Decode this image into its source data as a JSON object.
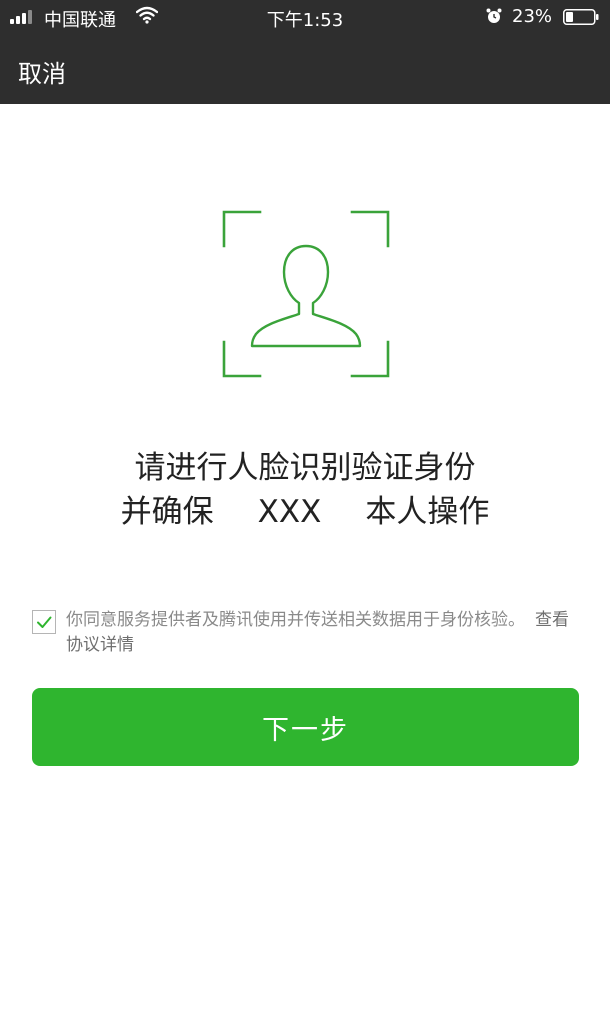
{
  "status_bar": {
    "carrier": "中国联通",
    "time": "下午1:53",
    "battery": "23%",
    "icons": [
      "signal-icon",
      "wifi-icon",
      "alarm-icon",
      "battery-icon"
    ]
  },
  "nav": {
    "cancel_label": "取消"
  },
  "face": {
    "icon": "face-scan-icon"
  },
  "prompt": {
    "line1": "请进行人脸识别验证身份",
    "line2_prefix": "并确保",
    "line2_name": "XXX",
    "line2_suffix": "本人操作"
  },
  "agreement": {
    "checked": true,
    "text": "你同意服务提供者及腾讯使用并传送相关数据用于身份核验。",
    "link": "查看协议详情"
  },
  "actions": {
    "next_label": "下一步"
  },
  "colors": {
    "accent": "#2fb52f",
    "header": "#2e2e2e",
    "frame": "#3aa33a"
  }
}
